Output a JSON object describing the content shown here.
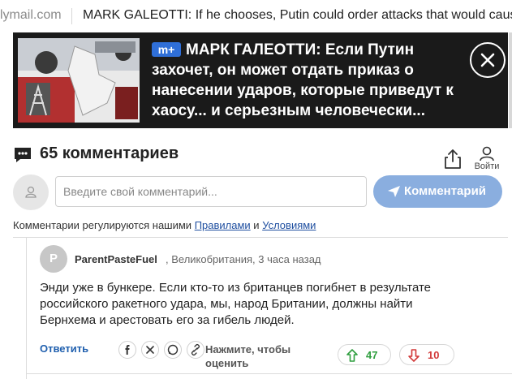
{
  "browser": {
    "tab_domain": "lymail.com",
    "tab_title": "MARK GALEOTTI: If he chooses, Putin could order attacks that would caus"
  },
  "header": {
    "badge_text": "m+",
    "headline": "МАРК ГАЛЕОТТИ: Если Путин захочет, он может отдать приказ о нанесении ударов, которые приведут к хаосу... и серьезным человечески..."
  },
  "comments": {
    "count_label": "65 комментариев",
    "login_label": "Войти",
    "input_placeholder": "Введите свой комментарий...",
    "submit_label": "Комментарий",
    "rules_prefix": "Комментарии регулируются нашими ",
    "rules_link": "Правилами",
    "rules_and": " и ",
    "terms_link": "Условиями"
  },
  "comment": {
    "avatar_letter": "P",
    "author": "ParentPasteFuel",
    "meta": ", Великобритания, 3 часа назад",
    "text": "Энди уже в бункере. Если кто-то из британцев погибнет в результате российского ракетного удара, мы, народ Британии, должны найти Бернхема и арестовать его за гибель людей.",
    "reply_label": "Ответить",
    "rate_hint": "Нажмите, чтобы оценить",
    "upvotes": "47",
    "downvotes": "10",
    "up_color": "#2e9e3e",
    "down_color": "#d23a3a",
    "accent": "#8aaedf"
  }
}
